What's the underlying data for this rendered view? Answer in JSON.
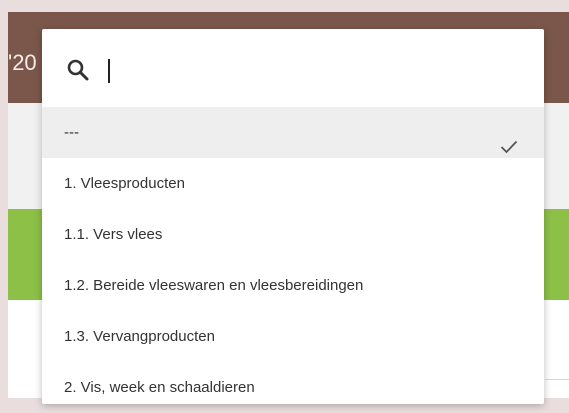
{
  "background": {
    "header_text": "'20",
    "colors": {
      "header": "#7a574a",
      "green_band": "#8cc046",
      "gray_band": "#f1f1f1",
      "page": "#e9dedd"
    }
  },
  "dropdown": {
    "search": {
      "icon": "search-icon",
      "value": "",
      "placeholder": ""
    },
    "options": [
      {
        "label": "---",
        "selected": true
      },
      {
        "label": "1. Vleesproducten",
        "selected": false
      },
      {
        "label": "1.1. Vers vlees",
        "selected": false
      },
      {
        "label": "1.2. Bereide vleeswaren en vleesbereidingen",
        "selected": false
      },
      {
        "label": "1.3. Vervangproducten",
        "selected": false
      },
      {
        "label": "2. Vis, week en schaaldieren",
        "selected": false
      }
    ],
    "selected_icon": "check-icon"
  }
}
